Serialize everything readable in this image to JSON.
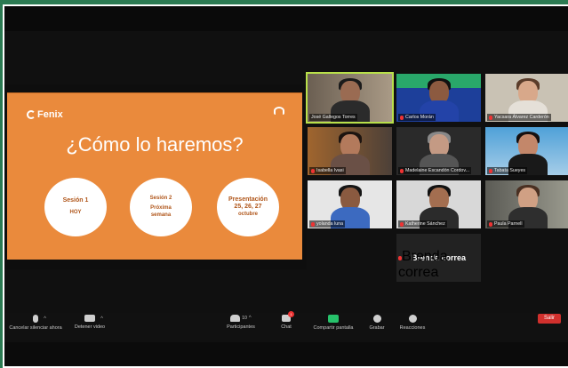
{
  "slide": {
    "logo_text": "Fenix",
    "logo_sub": "",
    "title": "¿Cómo lo haremos?",
    "circles": [
      {
        "line1": "Sesión 1",
        "line2": "HOY"
      },
      {
        "line1": "Sesión 2",
        "line2": "Próxima semana"
      },
      {
        "line1": "Presentación 25, 26, 27",
        "line2": "octubre"
      }
    ]
  },
  "participants": [
    {
      "name": "José Gallegos Torres",
      "muted": false
    },
    {
      "name": "Carlos Morán",
      "muted": true
    },
    {
      "name": "Yacsara Álvarez Carderón",
      "muted": true
    },
    {
      "name": "Isabella Ivasi",
      "muted": true
    },
    {
      "name": "Madelaine Escandón Cordov...",
      "muted": true
    },
    {
      "name": "Tabata Sueyes",
      "muted": true
    },
    {
      "name": "yolanda luna",
      "muted": true
    },
    {
      "name": "Katherine Sánchez",
      "muted": true
    },
    {
      "name": "Paula Parnell",
      "muted": true
    },
    {
      "name": "Brenda correa",
      "muted": true,
      "display": "Brenda correa"
    }
  ],
  "toolbar": {
    "mute_label": "Cancelar silenciar ahora",
    "video_label": "Detener video",
    "participants_label": "Participantes",
    "participants_count": "10",
    "chat_label": "Chat",
    "chat_badge": "1",
    "share_label": "Compartir pantalla",
    "record_label": "Grabar",
    "reactions_label": "Reacciones",
    "leave_label": "Salir"
  }
}
